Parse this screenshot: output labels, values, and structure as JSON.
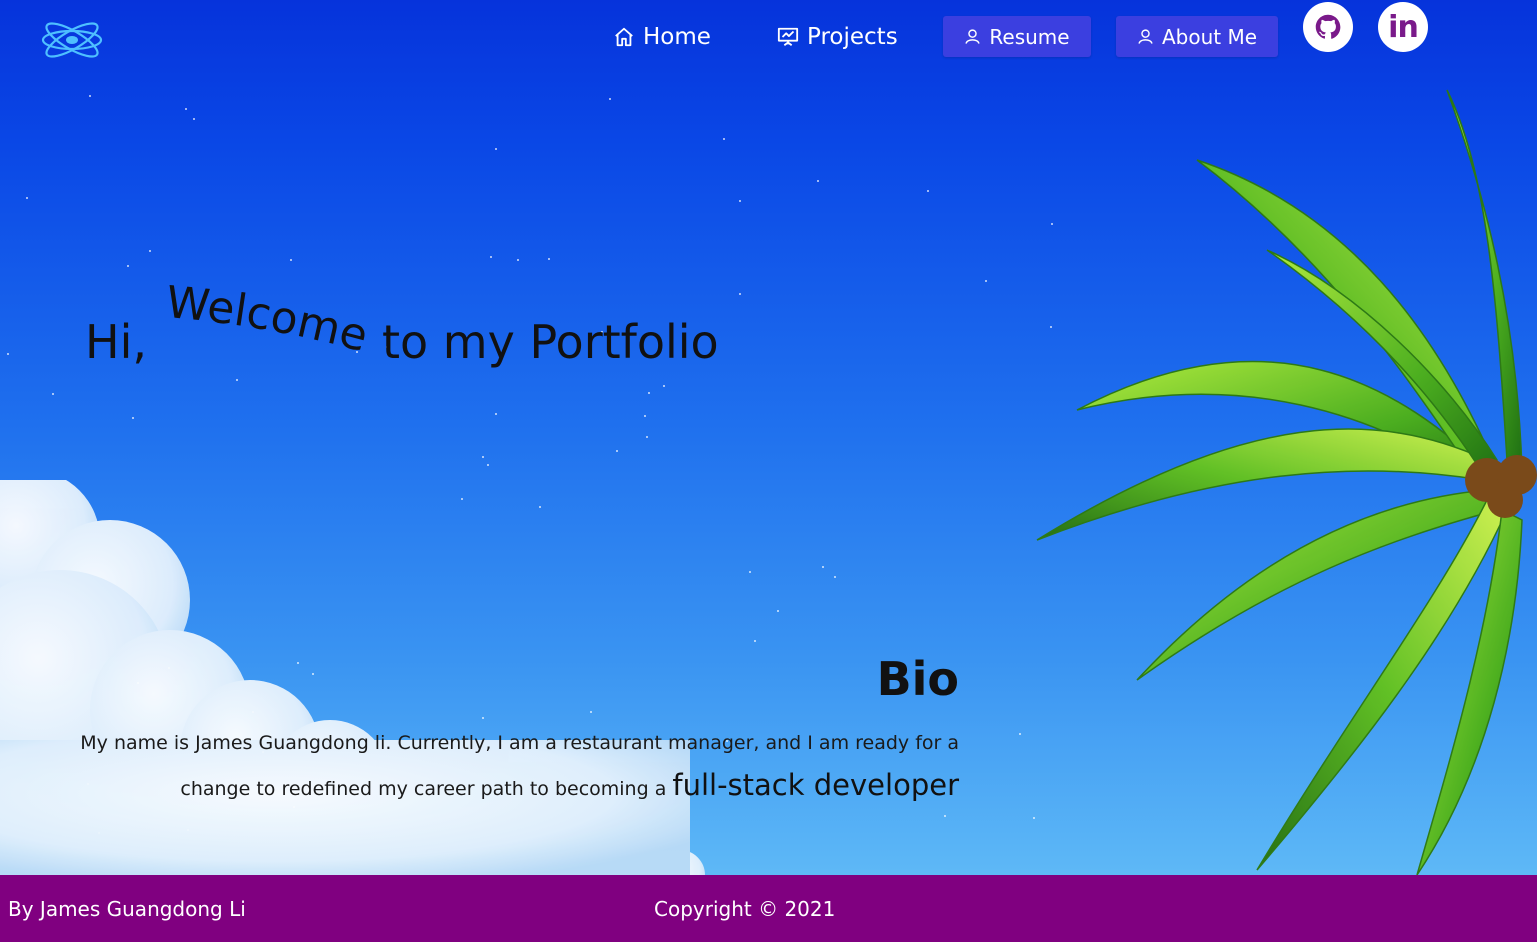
{
  "nav": {
    "logo": "react-atom-logo",
    "links": [
      {
        "label": "Home",
        "icon": "home-icon"
      },
      {
        "label": "Projects",
        "icon": "presentation-icon"
      }
    ],
    "buttons": [
      {
        "label": "Resume",
        "icon": "user-icon"
      },
      {
        "label": "About Me",
        "icon": "user-icon"
      }
    ],
    "social": [
      {
        "name": "GitHub",
        "icon": "github-icon"
      },
      {
        "name": "LinkedIn",
        "icon": "linkedin-icon",
        "glyph": "in"
      }
    ]
  },
  "hero": {
    "greeting": "Hi,",
    "animated_word": "Welcome",
    "rest": "to my Portfolio"
  },
  "bio": {
    "title": "Bio",
    "text": "My name is James Guangdong li. Currently, I am a restaurant manager, and I am ready for a change to redefined my career path to becoming a",
    "highlight": "full-stack developer"
  },
  "footer": {
    "author": "By James Guangdong Li",
    "copyright": "Copyright © 2021"
  },
  "colors": {
    "button": "#3b3fe0",
    "footer": "#800080",
    "logo": "#4ec0ff"
  }
}
